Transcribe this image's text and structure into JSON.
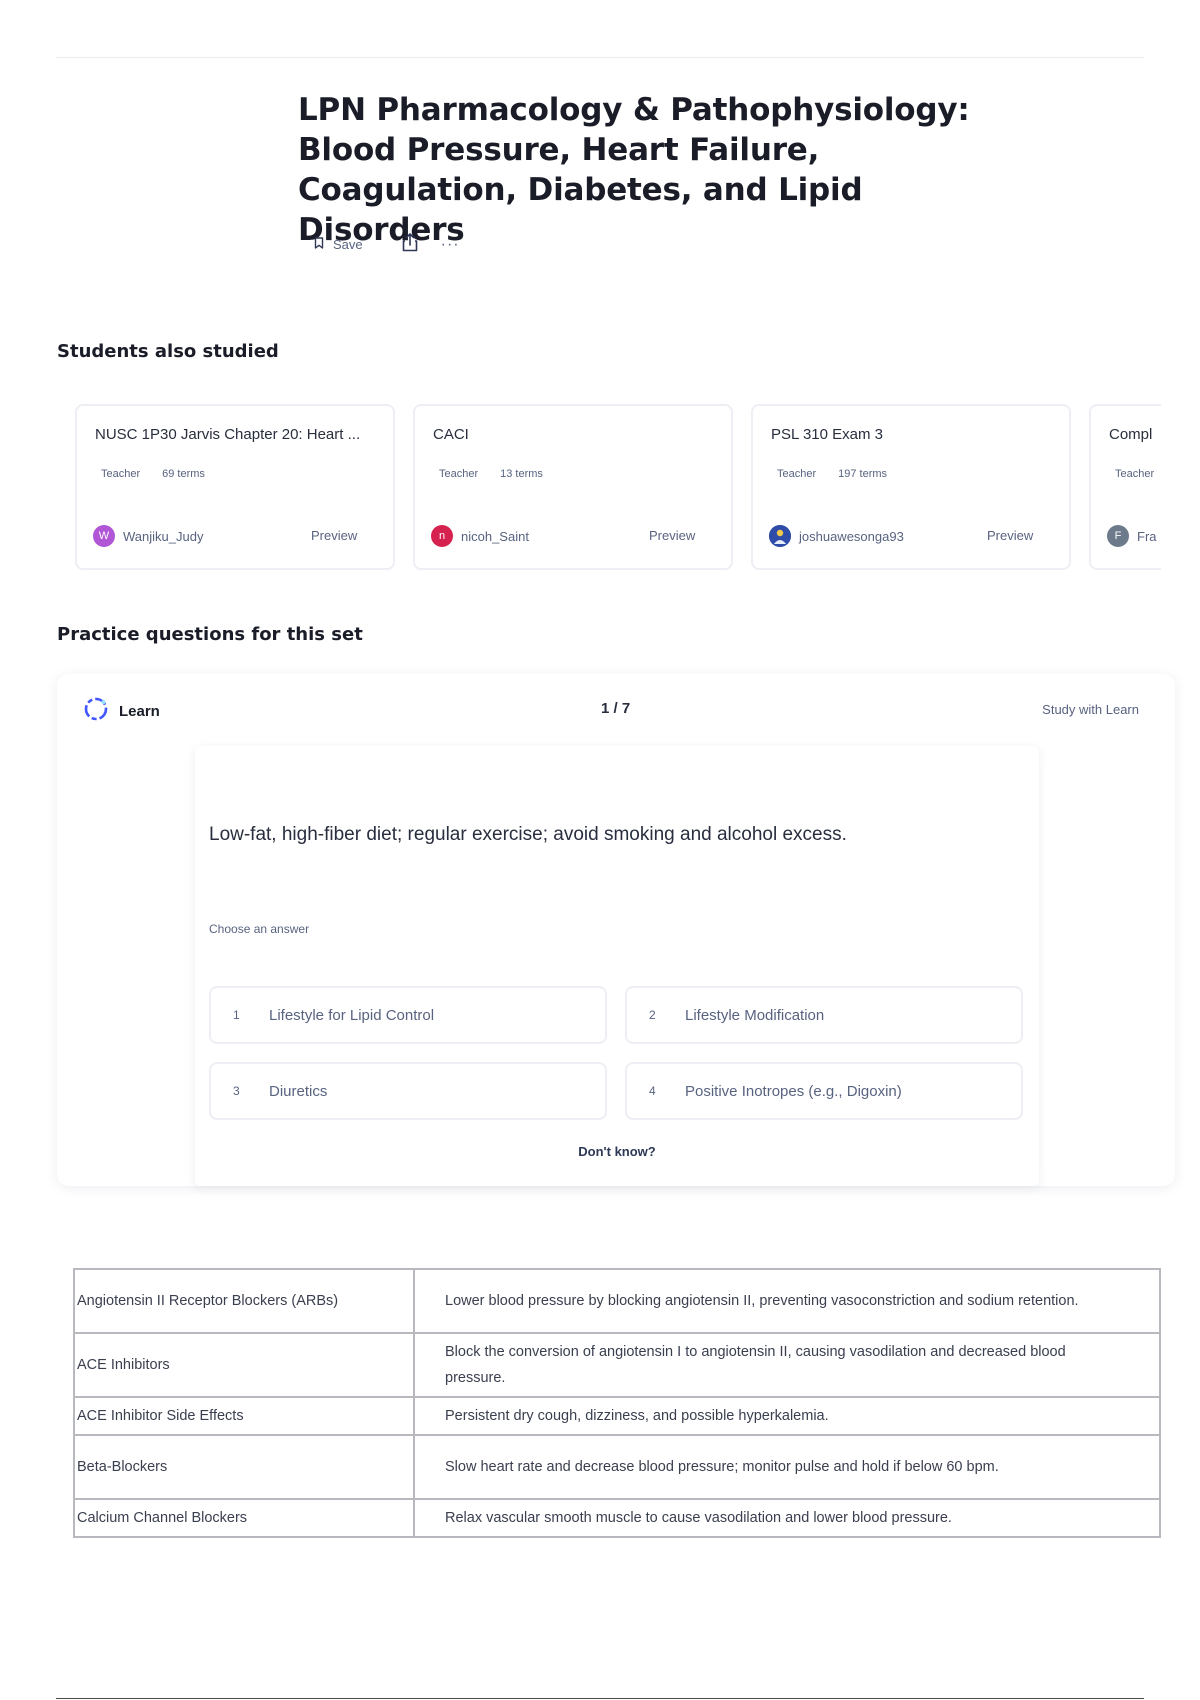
{
  "header": {
    "title": "LPN Pharmacology & Pathophysiology: Blood Pressure, Heart Failure, Coagulation, Diabetes, and Lipid Disorders",
    "save_label": "Save",
    "more_label": "···"
  },
  "students_also_studied": {
    "heading": "Students also studied",
    "cards": [
      {
        "title": "NUSC 1P30 Jarvis Chapter 20: Heart ...",
        "role": "Teacher",
        "terms": "69 terms",
        "avatar_letter": "W",
        "avatar_color": "#b157d6",
        "username": "Wanjiku_Judy",
        "preview_label": "Preview"
      },
      {
        "title": "CACI",
        "role": "Teacher",
        "terms": "13 terms",
        "avatar_letter": "n",
        "avatar_color": "#d6224e",
        "username": "nicoh_Saint",
        "preview_label": "Preview"
      },
      {
        "title": "PSL 310 Exam 3",
        "role": "Teacher",
        "terms": "197 terms",
        "avatar_letter": "",
        "avatar_color": "#2f4da8",
        "username": "joshuawesonga93",
        "preview_label": "Preview"
      },
      {
        "title": "Compl",
        "role": "Teacher",
        "terms": "",
        "avatar_letter": "F",
        "avatar_color": "#6c7a8c",
        "username": "Fra",
        "preview_label": ""
      }
    ]
  },
  "practice": {
    "heading": "Practice questions for this set",
    "mode_label": "Learn",
    "progress": "1 / 7",
    "study_link": "Study with Learn",
    "question": "Low-fat, high-fiber diet; regular exercise; avoid smoking and alcohol excess.",
    "prompt": "Choose an answer",
    "options": [
      {
        "num": "1",
        "label": "Lifestyle for Lipid Control"
      },
      {
        "num": "2",
        "label": "Lifestyle Modification"
      },
      {
        "num": "3",
        "label": "Diuretics"
      },
      {
        "num": "4",
        "label": "Positive Inotropes (e.g., Digoxin)"
      }
    ],
    "dont_know": "Don't know?"
  },
  "terms_table": [
    {
      "term": "Angiotensin II Receptor Blockers (ARBs)",
      "definition": "Lower blood pressure by blocking angiotensin II, preventing vasoconstriction and sodium retention."
    },
    {
      "term": "ACE Inhibitors",
      "definition": "Block the conversion of angiotensin I to angiotensin II, causing vasodilation and decreased blood pressure."
    },
    {
      "term": "ACE Inhibitor Side Effects",
      "definition": "Persistent dry cough, dizziness, and possible hyperkalemia."
    },
    {
      "term": "Beta-Blockers",
      "definition": "Slow heart rate and decrease blood pressure; monitor pulse and hold if below 60 bpm."
    },
    {
      "term": "Calcium Channel Blockers",
      "definition": "Relax vascular smooth muscle to cause vasodilation and lower blood pressure."
    }
  ],
  "colors": {
    "accent": "#4255ff",
    "text_dark": "#1a1d28",
    "text_muted": "#586380",
    "card_border": "#edeff4",
    "table_border": "#b7b9bf"
  },
  "icons": [
    "bookmark-icon",
    "share-icon",
    "more-icon",
    "learn-icon"
  ]
}
